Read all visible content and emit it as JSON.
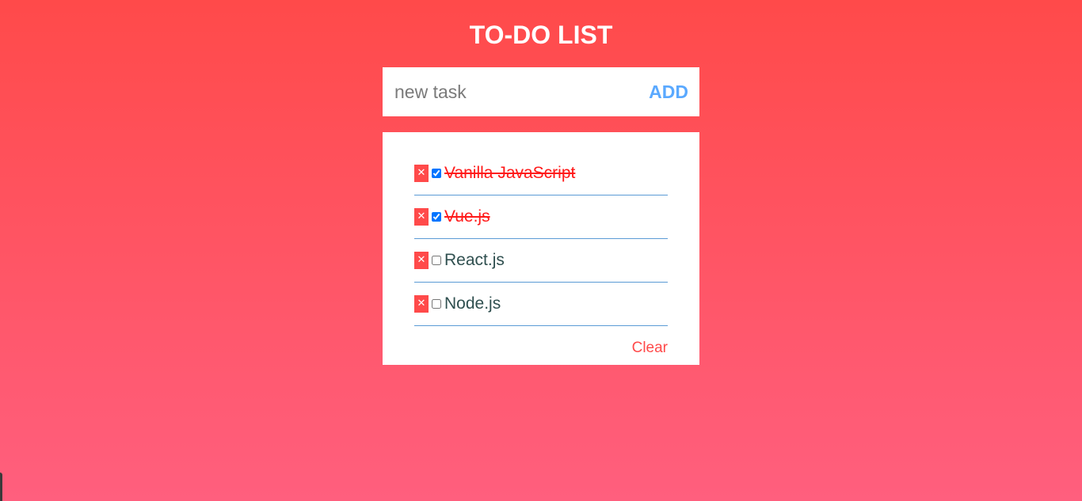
{
  "page": {
    "title": "TO-DO LIST"
  },
  "input": {
    "placeholder": "new task",
    "value": "",
    "add_label": "ADD"
  },
  "tasks": [
    {
      "label": "Vanilla JavaScript",
      "done": true,
      "delete_glyph": "✕"
    },
    {
      "label": "Vue.js",
      "done": true,
      "delete_glyph": "✕"
    },
    {
      "label": "React.js",
      "done": false,
      "delete_glyph": "✕"
    },
    {
      "label": "Node.js",
      "done": false,
      "delete_glyph": "✕"
    }
  ],
  "footer": {
    "clear_label": "Clear"
  },
  "colors": {
    "background_top": "#ff4a4a",
    "background_bottom": "#ff5f7e",
    "accent_blue": "#5aa9ff",
    "delete_red": "#ff4a4a",
    "done_text": "#ff1a1a",
    "pending_text": "#2f4f4f",
    "divider": "#5b9bd5"
  },
  "icons": {
    "delete": "close-icon"
  }
}
